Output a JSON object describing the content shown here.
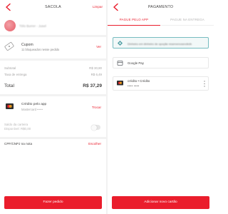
{
  "left": {
    "header": {
      "title": "SACOLA",
      "action": "Limpar"
    },
    "restaurant": {
      "name": "Tèlo Burrer - Jusel"
    },
    "coupon": {
      "title": "Cupom",
      "subtitle": "11 bloqueados nesse pedido",
      "action": "Ver"
    },
    "summary": {
      "subtotal_label": "Subtotal",
      "subtotal_value": "R$ 30,80",
      "fee_label": "Taxa de entrega",
      "fee_value": "R$ 6,49",
      "total_label": "Total",
      "total_value": "R$ 37,29"
    },
    "payment": {
      "title": "Crédito pelo app",
      "brand": "Mastercard",
      "masked": "••••",
      "action": "Trocar"
    },
    "wallet": {
      "label": "Saldo da carteira",
      "amount": "Disponível: R$0,00"
    },
    "cpf": {
      "label": "CPF/CNPJ na nota",
      "action": "Escolher"
    },
    "cta": "Fazer pedido"
  },
  "right": {
    "header": {
      "title": "PAGAMENTO"
    },
    "tabs": [
      {
        "label": "PAGUE PELO APP"
      },
      {
        "label": "PAGUE NA ENTREGA"
      }
    ],
    "options": [
      {
        "label": "Dinheiro em dinheiro de opoçãe reservenosevdicib"
      },
      {
        "label": "Google Pay"
      },
      {
        "label": "crédito • Crédito",
        "masked": "•••• ••••"
      }
    ],
    "cta": "Adicionar novo cartão"
  },
  "colors": {
    "accent": "#ea1d2c",
    "selected_border": "#76bcc0",
    "text": "#3f3e3e",
    "muted": "#a6a5a5"
  },
  "icons": [
    "chevron-left-icon",
    "coupon-icon",
    "mastercard-icon",
    "toggle-switch",
    "diamond-icon",
    "google-pay-icon",
    "more-vertical-icon"
  ]
}
